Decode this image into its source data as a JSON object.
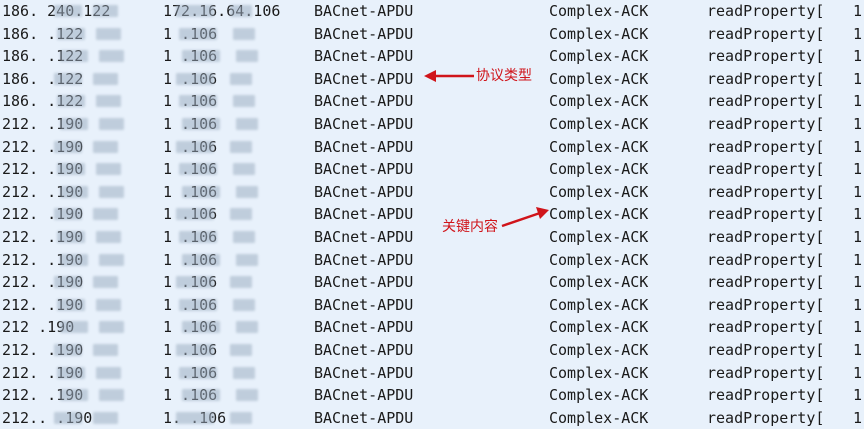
{
  "packet_list": {
    "rows": [
      {
        "src": "186. 240.122",
        "dst": "172.16.64.106",
        "protocol": "BACnet-APDU",
        "info": "Complex-ACK",
        "service": "readProperty[",
        "extra": "1"
      },
      {
        "src": "186.    .122",
        "dst": "1        .106",
        "protocol": "BACnet-APDU",
        "info": "Complex-ACK",
        "service": "readProperty[",
        "extra": "1"
      },
      {
        "src": "186.    .122",
        "dst": "1        .106",
        "protocol": "BACnet-APDU",
        "info": "Complex-ACK",
        "service": "readProperty[",
        "extra": "1"
      },
      {
        "src": "186.    .122",
        "dst": "1        .106",
        "protocol": "BACnet-APDU",
        "info": "Complex-ACK",
        "service": "readProperty[",
        "extra": "1"
      },
      {
        "src": "186.    .122",
        "dst": "1        .106",
        "protocol": "BACnet-APDU",
        "info": "Complex-ACK",
        "service": "readProperty[",
        "extra": "1"
      },
      {
        "src": "212.      .190",
        "dst": "1        .106",
        "protocol": "BACnet-APDU",
        "info": "Complex-ACK",
        "service": "readProperty[",
        "extra": "1"
      },
      {
        "src": "212.      .190",
        "dst": "1        .106",
        "protocol": "BACnet-APDU",
        "info": "Complex-ACK",
        "service": "readProperty[",
        "extra": "1"
      },
      {
        "src": "212.      .190",
        "dst": "1        .106",
        "protocol": "BACnet-APDU",
        "info": "Complex-ACK",
        "service": "readProperty[",
        "extra": "1"
      },
      {
        "src": "212.      .190",
        "dst": "1        .106",
        "protocol": "BACnet-APDU",
        "info": "Complex-ACK",
        "service": "readProperty[",
        "extra": "1"
      },
      {
        "src": "212.      .190",
        "dst": "1        .106",
        "protocol": "BACnet-APDU",
        "info": "Complex-ACK",
        "service": "readProperty[",
        "extra": "1"
      },
      {
        "src": "212.      .190",
        "dst": "1        .106",
        "protocol": "BACnet-APDU",
        "info": "Complex-ACK",
        "service": "readProperty[",
        "extra": "1"
      },
      {
        "src": "212.      .190",
        "dst": "1        .106",
        "protocol": "BACnet-APDU",
        "info": "Complex-ACK",
        "service": "readProperty[",
        "extra": "1"
      },
      {
        "src": "212.      .190",
        "dst": "1        .106",
        "protocol": "BACnet-APDU",
        "info": "Complex-ACK",
        "service": "readProperty[",
        "extra": "1"
      },
      {
        "src": "212.      .190",
        "dst": "1        .106",
        "protocol": "BACnet-APDU",
        "info": "Complex-ACK",
        "service": "readProperty[",
        "extra": "1"
      },
      {
        "src": "212       .190",
        "dst": "1        .106",
        "protocol": "BACnet-APDU",
        "info": "Complex-ACK",
        "service": "readProperty[",
        "extra": "1"
      },
      {
        "src": "212.      .190",
        "dst": "1        .106",
        "protocol": "BACnet-APDU",
        "info": "Complex-ACK",
        "service": "readProperty[",
        "extra": "1"
      },
      {
        "src": "212.      .190",
        "dst": "1        .106",
        "protocol": "BACnet-APDU",
        "info": "Complex-ACK",
        "service": "readProperty[",
        "extra": "1"
      },
      {
        "src": "212.      .190",
        "dst": "1        .106",
        "protocol": "BACnet-APDU",
        "info": "Complex-ACK",
        "service": "readProperty[",
        "extra": "1"
      },
      {
        "src": "212..     .190",
        "dst": "1.       .106",
        "protocol": "BACnet-APDU",
        "info": "Complex-ACK",
        "service": "readProperty[",
        "extra": "1"
      }
    ]
  },
  "annotations": {
    "protocol_type": "协议类型",
    "key_content": "关键内容"
  },
  "colors": {
    "background": "#e8f1fb",
    "annotation": "#d0141a"
  }
}
